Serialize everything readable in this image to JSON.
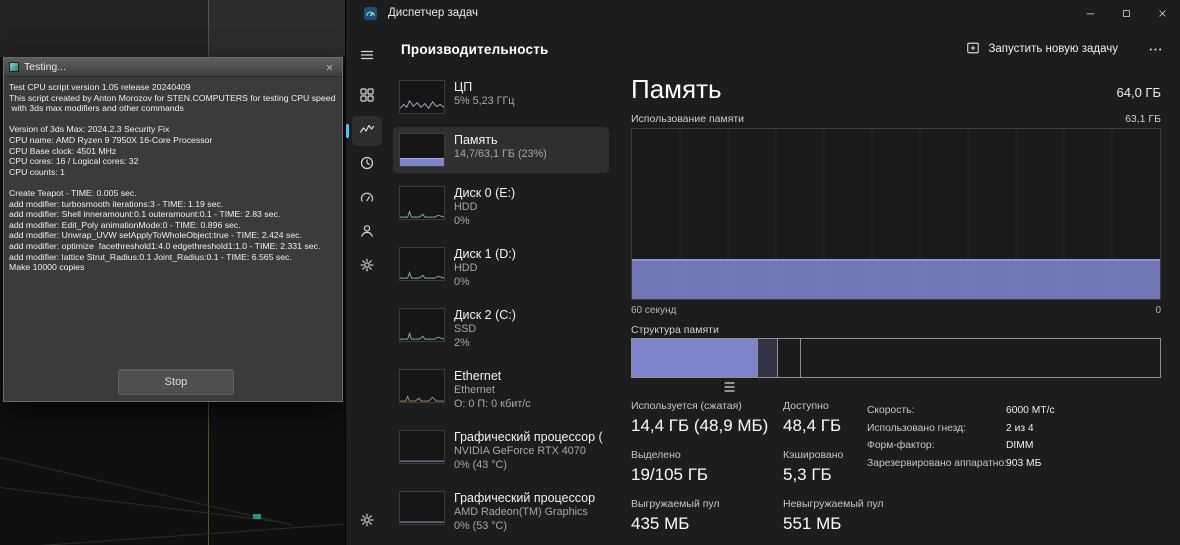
{
  "colors": {
    "accent_blue": "#4cc2ff",
    "memory_fill": "#7d84c9",
    "memory_line": "#a3a9e8",
    "graph_grid": "#292929"
  },
  "max_app": {
    "dialog": {
      "title": "Testing...",
      "stop_label": "Stop",
      "lines": [
        "Test CPU script version 1.05 release 20240409",
        "This script created by Anton Morozov for STEN.COMPUTERS for testing CPU speed",
        " with 3ds max modifiers and other commands",
        "",
        "Version of 3ds Max: 2024.2.3 Security Fix",
        "CPU name: AMD Ryzen 9 7950X 16-Core Processor",
        "CPU Base clock: 4501 MHz",
        "CPU cores: 16 / Logical cores: 32",
        "CPU counts: 1",
        "",
        "Create Teapot - TIME: 0.005 sec.",
        "add modifier: turbosmooth iterations:3 - TIME: 1.19 sec.",
        "add modifier: Shell inneramount:0.1 outeramount:0.1 - TIME: 2.83 sec.",
        "add modifier: Edit_Poly animationMode:0 - TIME: 0.896 sec.",
        "add modifier: Unwrap_UVW setApplyToWholeObject:true - TIME: 2.424 sec.",
        "add modifier: optimize  facethreshold1:4.0 edgethreshold1:1.0 - TIME: 2.331 sec.",
        "add modifier: lattice Strut_Radius:0.1 Joint_Radius:0.1 - TIME: 6.565 sec.",
        "Make 10000 copies"
      ]
    }
  },
  "taskmanager": {
    "titlebar": {
      "title": "Диспетчер задач"
    },
    "header": {
      "title": "Производительность",
      "run_new_task_label": "Запустить новую задачу"
    },
    "rail": {
      "items": [
        {
          "id": "menu",
          "icon": "hamburger"
        },
        {
          "id": "processes",
          "icon": "processes"
        },
        {
          "id": "performance",
          "icon": "performance",
          "selected": true
        },
        {
          "id": "app-history",
          "icon": "history"
        },
        {
          "id": "startup-apps",
          "icon": "startup"
        },
        {
          "id": "users",
          "icon": "users"
        },
        {
          "id": "details",
          "icon": "details"
        },
        {
          "id": "services",
          "icon": "services"
        }
      ]
    },
    "sidebar": {
      "items": [
        {
          "id": "cpu",
          "title": "ЦП",
          "lines": [
            "5% 5,23 ГГц"
          ],
          "thumb": "cpu"
        },
        {
          "id": "memory",
          "title": "Память",
          "lines": [
            "14,7/63,1 ГБ (23%)"
          ],
          "thumb": "memory",
          "selected": true
        },
        {
          "id": "disk0",
          "title": "Диск 0 (E:)",
          "lines": [
            "HDD",
            "0%"
          ],
          "thumb": "disk"
        },
        {
          "id": "disk1",
          "title": "Диск 1 (D:)",
          "lines": [
            "HDD",
            "0%"
          ],
          "thumb": "disk"
        },
        {
          "id": "disk2",
          "title": "Диск 2 (C:)",
          "lines": [
            "SSD",
            "2%"
          ],
          "thumb": "disk"
        },
        {
          "id": "ethernet",
          "title": "Ethernet",
          "lines": [
            "Ethernet",
            "О: 0 П: 0 кбит/с"
          ],
          "thumb": "net"
        },
        {
          "id": "gpu0",
          "title": "Графический процессор (",
          "lines": [
            "NVIDIA GeForce RTX 4070",
            "0% (43 °C)"
          ],
          "thumb": "gpu"
        },
        {
          "id": "gpu1",
          "title": "Графический процессор",
          "lines": [
            "AMD Radeon(TM) Graphics",
            "0% (53 °C)"
          ],
          "thumb": "gpu"
        }
      ]
    },
    "memory_panel": {
      "title": "Память",
      "total": "64,0 ГБ",
      "usage_label": "Использование памяти",
      "scale_max": "63,1 ГБ",
      "usage_percent": 23,
      "time_span_label": "60 секунд",
      "time_zero_label": "0",
      "composition_label": "Структура памяти",
      "composition_segments": [
        {
          "name": "in-use",
          "width_percent": 23.8,
          "fill": "solid"
        },
        {
          "name": "modified",
          "width_percent": 3.8,
          "fill": "light"
        },
        {
          "name": "standby",
          "width_percent": 4.4,
          "fill": "none"
        },
        {
          "name": "free",
          "width_percent": 68,
          "fill": "none"
        }
      ],
      "stats": [
        {
          "id": "in-use",
          "label": "Используется (сжатая)",
          "value": "14,4 ГБ (48,9 МБ)"
        },
        {
          "id": "available",
          "label": "Доступно",
          "value": "48,4 ГБ"
        },
        {
          "id": "committed",
          "label": "Выделено",
          "value": "19/105 ГБ"
        },
        {
          "id": "cached",
          "label": "Кэшировано",
          "value": "5,3 ГБ"
        },
        {
          "id": "paged-pool",
          "label": "Выгружаемый пул",
          "value": "435 МБ"
        },
        {
          "id": "non-paged-pool",
          "label": "Невыгружаемый пул",
          "value": "551 МБ"
        }
      ],
      "details": [
        {
          "id": "speed",
          "label": "Скорость:",
          "value": "6000 МТ/с"
        },
        {
          "id": "slots-used",
          "label": "Использовано гнезд:",
          "value": "2 из 4"
        },
        {
          "id": "form-factor",
          "label": "Форм-фактор:",
          "value": "DIMM"
        },
        {
          "id": "hw-reserved",
          "label": "Зарезервировано аппаратно:",
          "value": "903 МБ"
        }
      ]
    }
  }
}
